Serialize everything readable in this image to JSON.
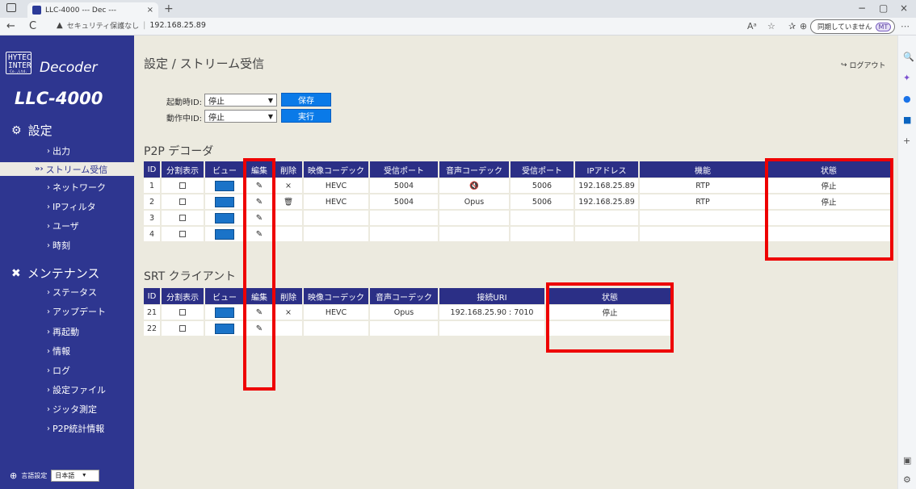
{
  "browser": {
    "tab_title": "LLC-4000 --- Dec ---",
    "tab_close": "×",
    "new_tab": "+",
    "insecure_label": "セキュリティ保護なし",
    "url": "192.168.25.89",
    "sync_label": "同期していません",
    "profile_initials": "MT",
    "back": "←",
    "reload": "C",
    "minimize": "−",
    "restore": "▢",
    "close": "×"
  },
  "sidebar": {
    "logo_line1": "HYTEC",
    "logo_line2": "INTER",
    "logo_line3": "Co.,Ltd.",
    "app_name": "Decoder",
    "product": "LLC-4000",
    "settings_header": "設定",
    "settings_items": [
      {
        "label": "出力"
      },
      {
        "label": "ストリーム受信",
        "active": true
      },
      {
        "label": "ネットワーク"
      },
      {
        "label": "IPフィルタ"
      },
      {
        "label": "ユーザ"
      },
      {
        "label": "時刻"
      }
    ],
    "maint_header": "メンテナンス",
    "maint_items": [
      {
        "label": "ステータス"
      },
      {
        "label": "アップデート"
      },
      {
        "label": "再起動"
      },
      {
        "label": "情報"
      },
      {
        "label": "ログ"
      },
      {
        "label": "設定ファイル"
      },
      {
        "label": "ジッタ測定"
      },
      {
        "label": "P2P統計情報"
      }
    ],
    "lang_label": "言語設定",
    "lang_value": "日本語"
  },
  "main": {
    "title": "設定 / ストリーム受信",
    "logout": "ログアウト",
    "startup_label": "起動時ID:",
    "startup_value": "停止",
    "save_button": "保存",
    "running_label": "動作中ID:",
    "running_value": "停止",
    "run_button": "実行"
  },
  "p2p": {
    "title": "P2P デコーダ",
    "headers": [
      "ID",
      "分割表示",
      "ビュー",
      "編集",
      "削除",
      "映像コーデック",
      "受信ポート",
      "音声コーデック",
      "受信ポート",
      "IPアドレス",
      "機能",
      "状態"
    ],
    "rows": [
      {
        "id": "1",
        "delete": "×",
        "vcodec": "HEVC",
        "vport": "5004",
        "acodec": "🔇",
        "aport": "5006",
        "ip": "192.168.25.89",
        "func": "RTP",
        "state": "停止"
      },
      {
        "id": "2",
        "delete": "🗑",
        "vcodec": "HEVC",
        "vport": "5004",
        "acodec": "Opus",
        "aport": "5006",
        "ip": "192.168.25.89",
        "func": "RTP",
        "state": "停止"
      },
      {
        "id": "3",
        "delete": "",
        "vcodec": "",
        "vport": "",
        "acodec": "",
        "aport": "",
        "ip": "",
        "func": "",
        "state": ""
      },
      {
        "id": "4",
        "delete": "",
        "vcodec": "",
        "vport": "",
        "acodec": "",
        "aport": "",
        "ip": "",
        "func": "",
        "state": ""
      }
    ]
  },
  "srt": {
    "title": "SRT クライアント",
    "headers": [
      "ID",
      "分割表示",
      "ビュー",
      "編集",
      "削除",
      "映像コーデック",
      "音声コーデック",
      "接続URI",
      "状態"
    ],
    "rows": [
      {
        "id": "21",
        "delete": "×",
        "vcodec": "HEVC",
        "acodec": "Opus",
        "uri": "192.168.25.90 : 7010",
        "state": "停止"
      },
      {
        "id": "22",
        "delete": "",
        "vcodec": "",
        "acodec": "",
        "uri": "",
        "state": ""
      }
    ]
  },
  "icons": {
    "edit": "edit-icon",
    "checkbox": "checkbox-icon",
    "view": "view-icon",
    "gear": "gear-icon",
    "tools": "tools-icon",
    "globe": "globe-icon"
  },
  "colors": {
    "nav_bg": "#2e3690",
    "header_bg": "#2b2f86",
    "content_bg": "#eceadf",
    "button": "#0a7ae8",
    "highlight": "#e00000"
  }
}
